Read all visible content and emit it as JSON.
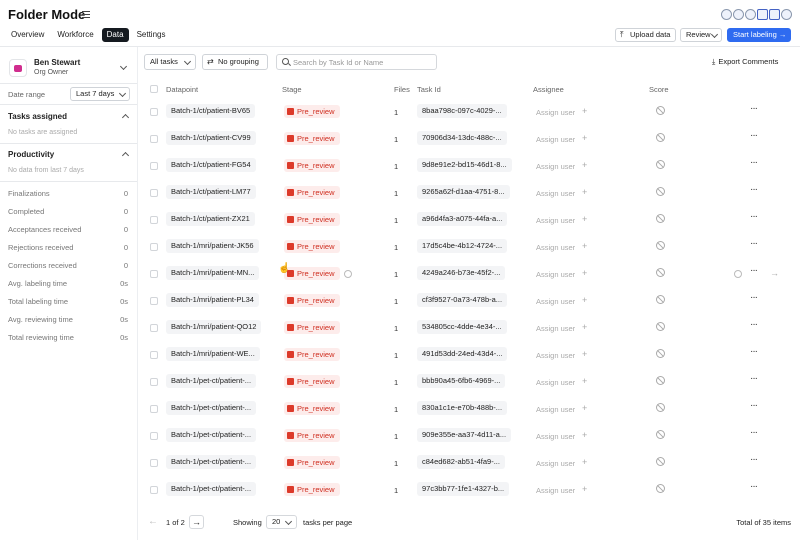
{
  "header": {
    "title": "Folder Mode",
    "tabs": [
      {
        "label": "Overview",
        "active": false
      },
      {
        "label": "Workforce",
        "active": false
      },
      {
        "label": "Data",
        "active": true
      },
      {
        "label": "Settings",
        "active": false
      }
    ],
    "upload_label": "Upload data",
    "review_label": "Review",
    "start_label": "Start labeling",
    "start_arrow": "→",
    "upload_icon": "upload-icon"
  },
  "sidebar": {
    "user_name": "Ben Stewart",
    "user_role": "Org Owner",
    "date_range_label": "Date range",
    "date_range_value": "Last 7 days",
    "tasks_assigned_title": "Tasks assigned",
    "tasks_assigned_empty": "No tasks are assigned",
    "productivity_title": "Productivity",
    "productivity_empty": "No data from last 7 days",
    "stats": [
      {
        "label": "Finalizations",
        "value": "0"
      },
      {
        "label": "Completed",
        "value": "0"
      },
      {
        "label": "Acceptances received",
        "value": "0"
      },
      {
        "label": "Rejections received",
        "value": "0"
      },
      {
        "label": "Corrections received",
        "value": "0"
      },
      {
        "label": "Avg. labeling time",
        "value": "0s"
      },
      {
        "label": "Total labeling time",
        "value": "0s"
      },
      {
        "label": "Avg. reviewing time",
        "value": "0s"
      },
      {
        "label": "Total reviewing time",
        "value": "0s"
      }
    ]
  },
  "toolbar": {
    "filter_label": "All tasks",
    "grouping_label": "No grouping",
    "search_placeholder": "Search by Task Id or Name",
    "export_label": "Export Comments"
  },
  "table": {
    "columns": [
      "Datapoint",
      "Stage",
      "Files",
      "Task Id",
      "Assignee",
      "Score"
    ],
    "assign_label": "Assign user",
    "more_glyph": "···",
    "rows": [
      {
        "datapoint": "Batch-1/ct/patient-BV65",
        "stage": "Pre_review",
        "files": "1",
        "task_id": "8baa798c-097c-4029-..."
      },
      {
        "datapoint": "Batch-1/ct/patient-CV99",
        "stage": "Pre_review",
        "files": "1",
        "task_id": "70906d34-13dc-488c-..."
      },
      {
        "datapoint": "Batch-1/ct/patient-FG54",
        "stage": "Pre_review",
        "files": "1",
        "task_id": "9d8e91e2-bd15-46d1-8..."
      },
      {
        "datapoint": "Batch-1/ct/patient-LM77",
        "stage": "Pre_review",
        "files": "1",
        "task_id": "9265a62f-d1aa-4751-8..."
      },
      {
        "datapoint": "Batch-1/ct/patient-ZX21",
        "stage": "Pre_review",
        "files": "1",
        "task_id": "a96d4fa3-a075-44fa-a..."
      },
      {
        "datapoint": "Batch-1/mri/patient-JK56",
        "stage": "Pre_review",
        "files": "1",
        "task_id": "17d5c4be-4b12-4724-..."
      },
      {
        "datapoint": "Batch-1/mri/patient-MN...",
        "stage": "Pre_review",
        "files": "1",
        "task_id": "4249a246-b73e-45f2-..."
      },
      {
        "datapoint": "Batch-1/mri/patient-PL34",
        "stage": "Pre_review",
        "files": "1",
        "task_id": "cf3f9527-0a73-478b-a..."
      },
      {
        "datapoint": "Batch-1/mri/patient-QO12",
        "stage": "Pre_review",
        "files": "1",
        "task_id": "534805cc-4dde-4e34-..."
      },
      {
        "datapoint": "Batch-1/mri/patient-WE...",
        "stage": "Pre_review",
        "files": "1",
        "task_id": "491d53dd-24ed-43d4-..."
      },
      {
        "datapoint": "Batch-1/pet-ct/patient-...",
        "stage": "Pre_review",
        "files": "1",
        "task_id": "bbb90a45-6fb6-4969-..."
      },
      {
        "datapoint": "Batch-1/pet-ct/patient-...",
        "stage": "Pre_review",
        "files": "1",
        "task_id": "830a1c1e-e70b-488b-..."
      },
      {
        "datapoint": "Batch-1/pet-ct/patient-...",
        "stage": "Pre_review",
        "files": "1",
        "task_id": "909e355e-aa37-4d11-a..."
      },
      {
        "datapoint": "Batch-1/pet-ct/patient-...",
        "stage": "Pre_review",
        "files": "1",
        "task_id": "c84ed682-ab51-4fa9-..."
      },
      {
        "datapoint": "Batch-1/pet-ct/patient-...",
        "stage": "Pre_review",
        "files": "1",
        "task_id": "97c3bb77-1fe1-4327-b..."
      }
    ]
  },
  "footer": {
    "page_info": "1 of 2",
    "showing_label": "Showing",
    "per_page_value": "20",
    "per_page_label": "tasks per page",
    "total_label": "Total of 35 items",
    "prev_glyph": "←",
    "next_glyph": "→"
  },
  "colors": {
    "accent": "#2f6bf0",
    "stage_bg": "#fdeceb",
    "stage_text": "#cf2e20"
  }
}
